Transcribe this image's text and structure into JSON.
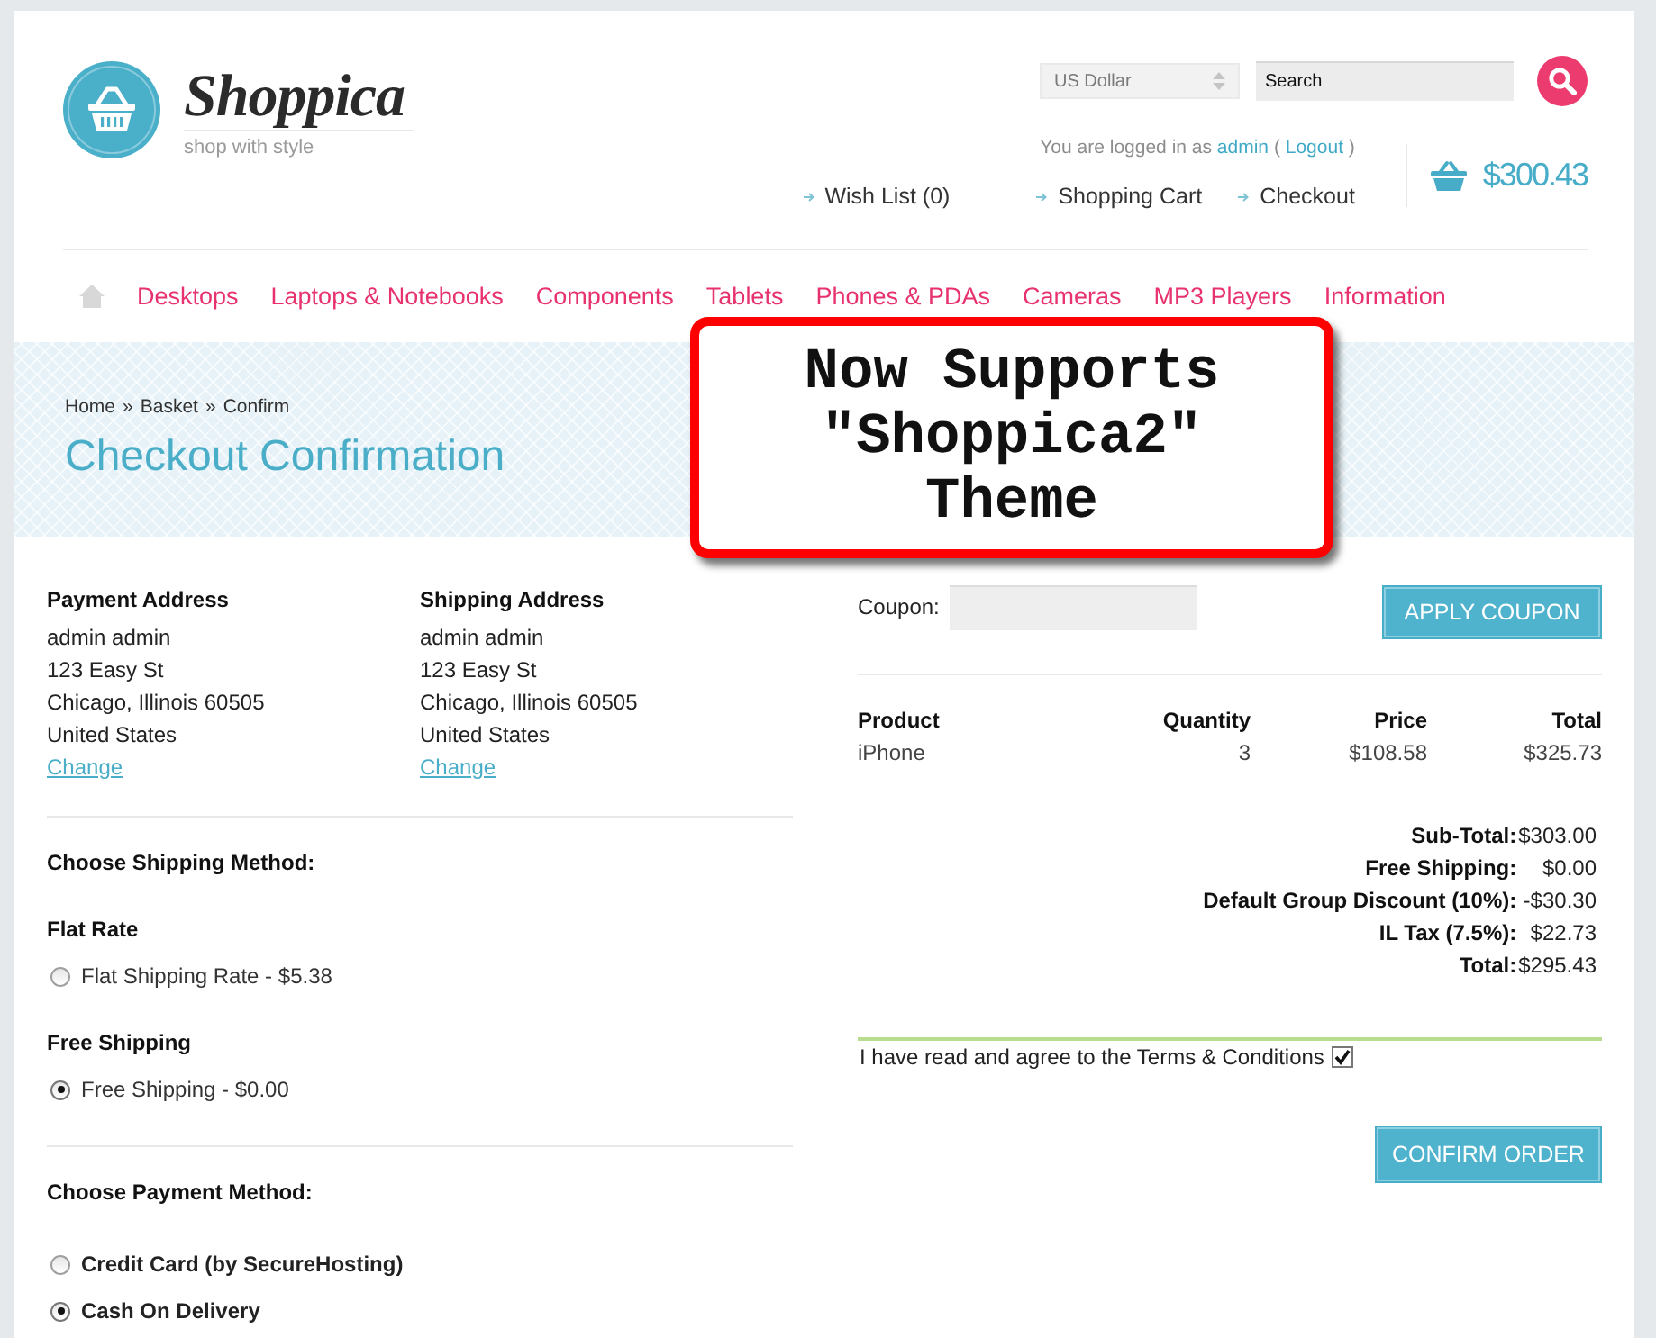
{
  "header": {
    "logo": {
      "name": "Shoppica",
      "tagline": "shop with style"
    },
    "currency": {
      "value": "US Dollar"
    },
    "search": {
      "value": "Search"
    },
    "login": {
      "prefix": "You are logged in as",
      "user": "admin",
      "open": "(",
      "logout": "Logout",
      "close": ")"
    },
    "links": [
      "Wish List (0)",
      "Shopping Cart",
      "Checkout"
    ],
    "cart": {
      "total": "$300.43"
    }
  },
  "nav": {
    "items": [
      "Desktops",
      "Laptops & Notebooks",
      "Components",
      "Tablets",
      "Phones & PDAs",
      "Cameras",
      "MP3 Players",
      "Information"
    ]
  },
  "banner": {
    "breadcrumb": {
      "links": [
        "Home",
        "Basket",
        "Confirm"
      ],
      "separators": [
        "»",
        "»"
      ]
    },
    "title": "Checkout Confirmation"
  },
  "callout": {
    "text": "Now Supports \"Shoppica2\" Theme"
  },
  "addresses": [
    {
      "title": "Payment Address",
      "lines": [
        "admin admin",
        "123 Easy St",
        "Chicago, Illinois 60505",
        "United States"
      ],
      "link": "Change"
    },
    {
      "title": "Shipping Address",
      "lines": [
        "admin admin",
        "123 Easy St",
        "Chicago, Illinois 60505",
        "United States"
      ],
      "link": "Change"
    }
  ],
  "shipping": {
    "title": "Choose Shipping Method:",
    "groups": [
      {
        "title": "Flat Rate",
        "options": [
          {
            "label": "Flat Shipping Rate - $5.38",
            "selected": false
          }
        ]
      },
      {
        "title": "Free Shipping",
        "options": [
          {
            "label": "Free Shipping - $0.00",
            "selected": true
          }
        ]
      }
    ]
  },
  "payment": {
    "title": "Choose Payment Method:",
    "options": [
      {
        "label": "Credit Card (by SecureHosting)",
        "selected": false
      },
      {
        "label": "Cash On Delivery",
        "selected": true
      }
    ]
  },
  "coupon": {
    "label": "Coupon:",
    "button": "APPLY COUPON"
  },
  "cart_table": {
    "columns": [
      "Product",
      "Quantity",
      "Price",
      "Total"
    ],
    "rows": [
      [
        "iPhone",
        "3",
        "$108.58",
        "$325.73"
      ]
    ]
  },
  "totals": [
    {
      "label": "Sub-Total:",
      "value": "$303.00"
    },
    {
      "label": "Free Shipping:",
      "value": "$0.00"
    },
    {
      "label": "Default Group Discount (10%):",
      "value": "-$30.30"
    },
    {
      "label": "IL Tax (7.5%):",
      "value": "$22.73"
    },
    {
      "label": "Total:",
      "value": "$295.43"
    }
  ],
  "terms": {
    "text": "I have read and agree to the Terms & Conditions",
    "checked": true
  },
  "confirm_button": "CONFIRM ORDER"
}
